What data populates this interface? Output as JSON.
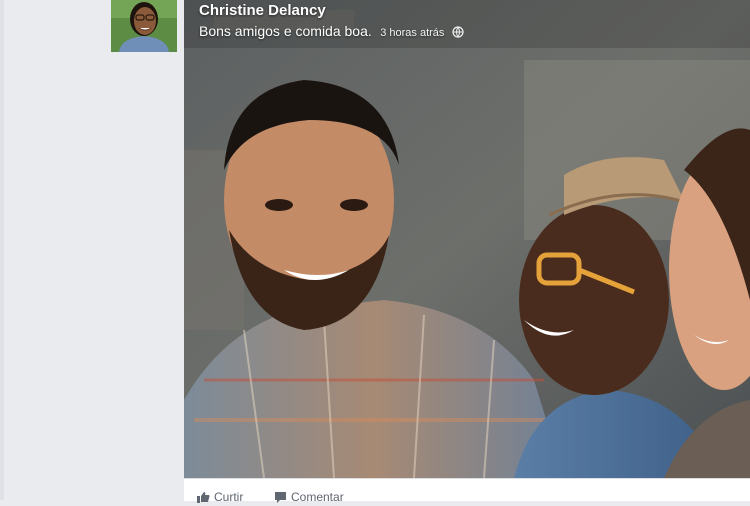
{
  "post": {
    "author": "Christine Delancy",
    "text": "Bons amigos e comida boa.",
    "timestamp": "3 horas atrás",
    "privacy_icon": "globe-icon"
  },
  "actions": {
    "like_label": "Curtir",
    "comment_label": "Comentar"
  },
  "colors": {
    "page_background": "#e9ebee",
    "action_bar": "#ffffff",
    "action_text": "#606770"
  }
}
